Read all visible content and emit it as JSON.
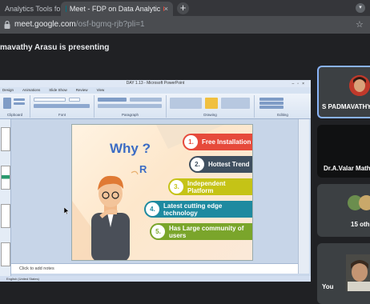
{
  "browser": {
    "tabs": [
      {
        "title": "Analytics Tools for ",
        "close": "×"
      },
      {
        "title": "Meet - FDP on Data Analytic",
        "close": "×"
      }
    ],
    "new_tab": "+",
    "url": {
      "host": "meet.google.com",
      "path": "/osf-bgmq-rjb?pli=1"
    }
  },
  "meet": {
    "presenting": "mavathy Arasu is presenting"
  },
  "powerpoint": {
    "title": "DAY 1.13 - Microsoft PowerPoint",
    "tabs": [
      "Design",
      "Animations",
      "Slide Show",
      "Review",
      "View"
    ],
    "groups": [
      "Clipboard",
      "Font",
      "Paragraph",
      "Drawing",
      "Editing"
    ],
    "notes_placeholder": "Click to add notes",
    "status": "English (United States)"
  },
  "slide": {
    "why": "Why ?",
    "r": "R",
    "items": [
      {
        "num": "1.",
        "text": "Free Installation",
        "color": "#e64a3b"
      },
      {
        "num": "2.",
        "text": "Hottest Trend",
        "color": "#3f4f5f"
      },
      {
        "num": "3.",
        "text": "Independent Platform",
        "color": "#c5c316"
      },
      {
        "num": "4.",
        "text": "Latest cutting edge technology",
        "color": "#1e8aa0"
      },
      {
        "num": "5.",
        "text": "Has Large community of users",
        "color": "#7aa52b"
      }
    ]
  },
  "participants": [
    {
      "name": "S PADMAVATHY"
    },
    {
      "name": "Dr.A.Valar Math"
    },
    {
      "name": "15 oth"
    },
    {
      "name": "You"
    }
  ]
}
